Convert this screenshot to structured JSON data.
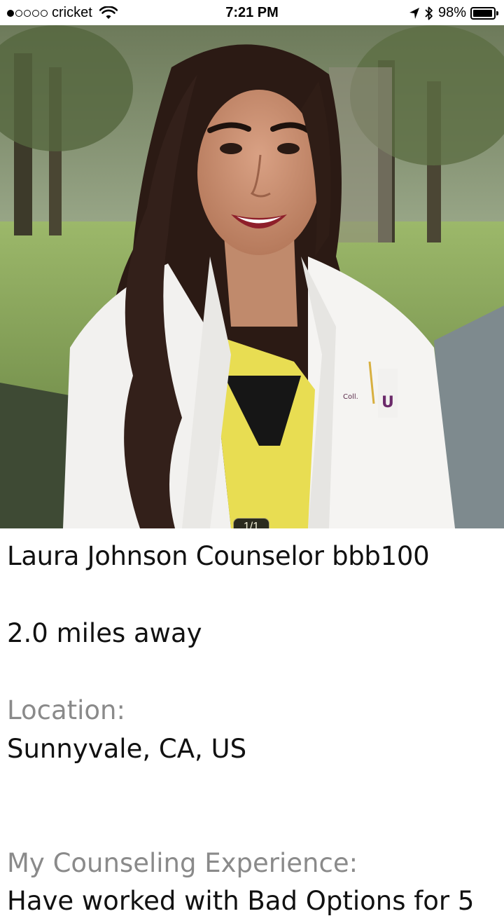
{
  "status_bar": {
    "carrier": "cricket",
    "time": "7:21 PM",
    "battery_percent": "98%",
    "battery_level": 0.98,
    "signal_bars_filled": 1,
    "signal_bars_total": 5,
    "icons": [
      "wifi-icon",
      "location-arrow-icon",
      "bluetooth-icon",
      "battery-icon"
    ]
  },
  "photo": {
    "counter": "1/1"
  },
  "profile": {
    "name_line": "Laura Johnson Counselor bbb100",
    "distance": "2.0 miles away",
    "location_label": "Location:",
    "location_value": "Sunnyvale, CA, US",
    "experience_label": "My Counseling Experience:",
    "experience_value": "Have worked with Bad Options for 5"
  },
  "colors": {
    "label_gray": "#8a8a8a",
    "text": "#111111",
    "background": "#ffffff"
  }
}
